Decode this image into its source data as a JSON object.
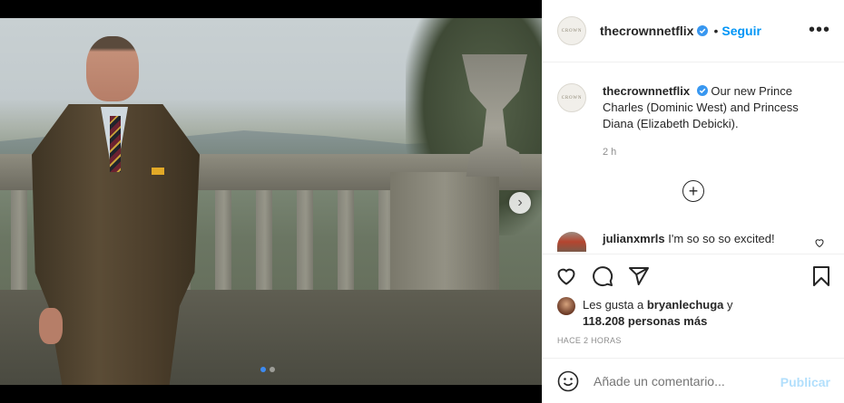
{
  "post": {
    "carousel": {
      "slides": 2,
      "active_slide": 1,
      "next_icon": "chevron-right-icon"
    }
  },
  "header": {
    "avatar_text": "CROWN",
    "username": "thecrownnetflix",
    "separator": "•",
    "follow_label": "Seguir",
    "more_icon": "more-horizontal-icon",
    "more_glyph": "•••"
  },
  "caption": {
    "username": "thecrownnetflix",
    "text": "Our new Prince Charles (Dominic West) and Princess Diana (Elizabeth Debicki).",
    "time": "2 h"
  },
  "load_more_glyph": "+",
  "comments": [
    {
      "username": "julianxmrls",
      "text": "I'm so so so excited!"
    }
  ],
  "actions": {
    "likes_prefix": "Les gusta a",
    "likes_user": "bryanlechuga",
    "likes_and": "y",
    "likes_count": "118.208 personas más",
    "posted_ago": "HACE 2 HORAS"
  },
  "add_comment": {
    "placeholder": "Añade un comentario...",
    "post_label": "Publicar"
  },
  "colors": {
    "accent": "#0095f6",
    "verified": "#3897f0",
    "post_disabled": "#b2dffc"
  }
}
